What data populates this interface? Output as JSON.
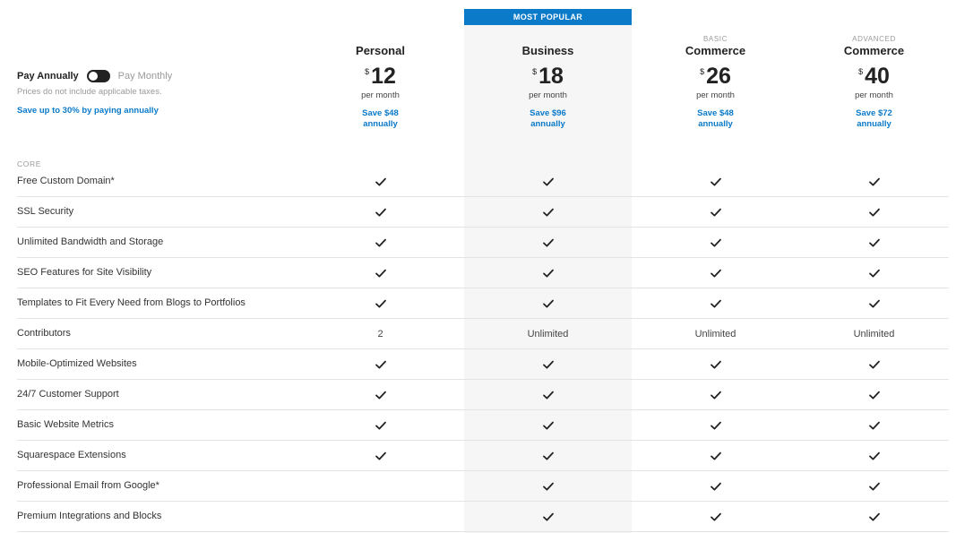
{
  "banner": {
    "label": "MOST POPULAR"
  },
  "billing": {
    "annual_label": "Pay Annually",
    "monthly_label": "Pay Monthly",
    "tax_note": "Prices do not include applicable taxes.",
    "save_note": "Save up to 30% by paying annually",
    "selected": "annually"
  },
  "plans": [
    {
      "subtitle": "",
      "name": "Personal",
      "currency": "$",
      "price": "12",
      "period": "per month",
      "save_line1": "Save $48",
      "save_line2": "annually"
    },
    {
      "subtitle": "",
      "name": "Business",
      "currency": "$",
      "price": "18",
      "period": "per month",
      "save_line1": "Save $96",
      "save_line2": "annually"
    },
    {
      "subtitle": "BASIC",
      "name": "Commerce",
      "currency": "$",
      "price": "26",
      "period": "per month",
      "save_line1": "Save $48",
      "save_line2": "annually"
    },
    {
      "subtitle": "ADVANCED",
      "name": "Commerce",
      "currency": "$",
      "price": "40",
      "period": "per month",
      "save_line1": "Save $72",
      "save_line2": "annually"
    }
  ],
  "section": {
    "label": "CORE"
  },
  "features": [
    {
      "name": "Free Custom Domain*",
      "values": [
        "check",
        "check",
        "check",
        "check"
      ]
    },
    {
      "name": "SSL Security",
      "values": [
        "check",
        "check",
        "check",
        "check"
      ]
    },
    {
      "name": "Unlimited Bandwidth and Storage",
      "values": [
        "check",
        "check",
        "check",
        "check"
      ]
    },
    {
      "name": "SEO Features for Site Visibility",
      "values": [
        "check",
        "check",
        "check",
        "check"
      ]
    },
    {
      "name": "Templates to Fit Every Need from Blogs to Portfolios",
      "values": [
        "check",
        "check",
        "check",
        "check"
      ]
    },
    {
      "name": "Contributors",
      "values": [
        "2",
        "Unlimited",
        "Unlimited",
        "Unlimited"
      ]
    },
    {
      "name": "Mobile-Optimized Websites",
      "values": [
        "check",
        "check",
        "check",
        "check"
      ]
    },
    {
      "name": "24/7 Customer Support",
      "values": [
        "check",
        "check",
        "check",
        "check"
      ]
    },
    {
      "name": "Basic Website Metrics",
      "values": [
        "check",
        "check",
        "check",
        "check"
      ]
    },
    {
      "name": "Squarespace Extensions",
      "values": [
        "check",
        "check",
        "check",
        "check"
      ]
    },
    {
      "name": "Professional Email from Google*",
      "values": [
        "",
        "check",
        "check",
        "check"
      ]
    },
    {
      "name": "Premium Integrations and Blocks",
      "values": [
        "",
        "check",
        "check",
        "check"
      ]
    }
  ],
  "icons": {
    "check": "checkmark-icon"
  },
  "colors": {
    "accent": "#0a7ac9",
    "highlight_column": "#f6f6f6",
    "toggle": "#222222"
  }
}
